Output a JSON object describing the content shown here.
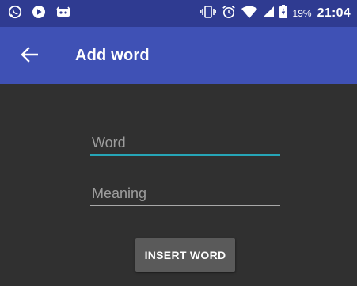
{
  "status_bar": {
    "left_icons": [
      "whatsapp-icon",
      "play-icon",
      "android-debug-icon"
    ],
    "right_icons": [
      "vibrate-icon",
      "alarm-icon",
      "wifi-icon",
      "signal-icon",
      "battery-charging-icon"
    ],
    "battery": "19%",
    "time": "21:04"
  },
  "toolbar": {
    "title": "Add word",
    "back_icon": "arrow-back-icon"
  },
  "form": {
    "word": {
      "placeholder": "Word",
      "value": ""
    },
    "meaning": {
      "placeholder": "Meaning",
      "value": ""
    },
    "insert_label": "INSERT WORD"
  },
  "colors": {
    "status_bar": "#2f3b91",
    "toolbar": "#3f51b5",
    "background": "#303030",
    "accent": "#26a5b7",
    "button": "#5a5a5a"
  }
}
